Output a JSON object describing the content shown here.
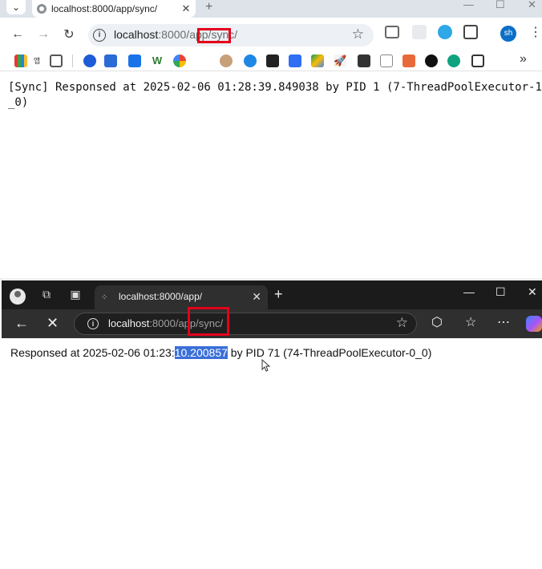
{
  "top_window": {
    "tab_title": "localhost:8000/app/sync/",
    "url_host": "localhost",
    "url_port_path": ":8000/app/sync/",
    "url_highlight": "sync/",
    "new_tab": "+",
    "window_controls": [
      "—",
      "☐",
      "✕"
    ],
    "profile_initials": "sh",
    "more_bookmarks": "»",
    "body_text": "[Sync] Responsed at 2025-02-06 01:28:39.849038 by PID 1 (7-ThreadPoolExecutor-1_0)"
  },
  "bottom_window": {
    "tab_title": "localhost:8000/app/",
    "url_host": "localhost",
    "url_port_path": ":8000/app/sync/",
    "new_tab": "+",
    "window_controls": [
      "—",
      "☐",
      "✕"
    ],
    "body_text_before": "Responsed at 2025-02-06 01:23:",
    "body_text_selected": "10.200857",
    "body_text_after": " by PID 71 (74-ThreadPoolExecutor-0_0)"
  },
  "colors": {
    "highlight_box": "#e3001b",
    "selection": "#3a6fd8",
    "edge_dark": "#1b1b1b",
    "chrome_tabstrip": "#dee3ea"
  },
  "icons": {
    "top_toolbar": [
      "back-arrow-icon",
      "forward-arrow-icon",
      "reload-icon",
      "site-info-icon",
      "bookmark-star-icon",
      "camera-icon",
      "extension-icon",
      "puzzle-icon",
      "more-icon"
    ],
    "bottom_toolbar": [
      "back-arrow-icon",
      "stop-loading-icon",
      "site-info-icon",
      "favorite-star-icon",
      "extensions-icon",
      "favorites-icon",
      "more-icon",
      "copilot-icon"
    ]
  }
}
